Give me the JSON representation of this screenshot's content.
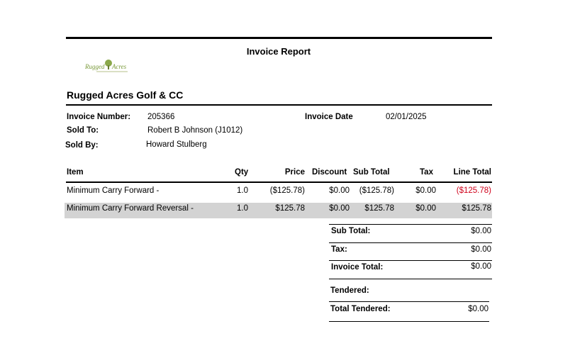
{
  "report": {
    "title": "Invoice Report",
    "logo_text": "Rugged Acres",
    "company": "Rugged Acres Golf & CC"
  },
  "info": {
    "invoice_number_label": "Invoice Number:",
    "invoice_number": "205366",
    "invoice_date_label": "Invoice Date",
    "invoice_date": "02/01/2025",
    "sold_to_label": "Sold To:",
    "sold_to": "Robert B Johnson (J1012)",
    "sold_by_label": "Sold By:",
    "sold_by": "Howard Stulberg"
  },
  "table": {
    "headers": {
      "item": "Item",
      "qty": "Qty",
      "price": "Price",
      "discount": "Discount",
      "subtotal": "Sub Total",
      "tax": "Tax",
      "line_total": "Line Total"
    },
    "rows": [
      {
        "item": "Minimum Carry Forward -",
        "qty": "1.0",
        "price": "($125.78)",
        "discount": "$0.00",
        "subtotal": "($125.78)",
        "tax": "$0.00",
        "line_total": "($125.78)"
      },
      {
        "item": "Minimum Carry Forward Reversal -",
        "qty": "1.0",
        "price": "$125.78",
        "discount": "$0.00",
        "subtotal": "$125.78",
        "tax": "$0.00",
        "line_total": "$125.78"
      }
    ]
  },
  "totals": {
    "subtotal_label": "Sub Total:",
    "subtotal": "$0.00",
    "tax_label": "Tax:",
    "tax": "$0.00",
    "invoice_total_label": "Invoice Total:",
    "invoice_total": "$0.00",
    "tendered_label": "Tendered:",
    "total_tendered_label": "Total Tendered:",
    "total_tendered": "$0.00"
  },
  "colors": {
    "negative": "#d0021b",
    "alt_row": "#d3d3d3",
    "logo_green": "#7a9a3a"
  }
}
